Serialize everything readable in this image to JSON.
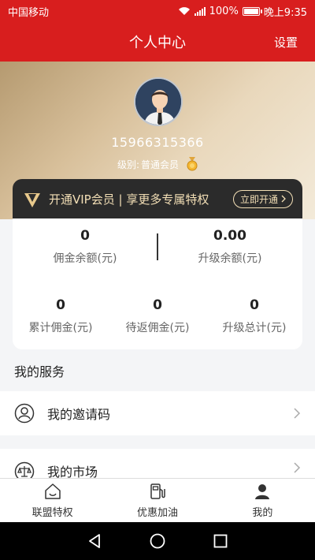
{
  "status_bar": {
    "carrier": "中国移动",
    "battery": "100%",
    "time": "晚上9:35"
  },
  "nav": {
    "title": "个人中心",
    "settings": "设置"
  },
  "profile": {
    "phone": "15966315366",
    "level_label": "级别:",
    "level_value": "普通会员"
  },
  "vip": {
    "text": "开通VIP会员 | 享更多专属特权",
    "button": "立即开通"
  },
  "stats": {
    "commission_balance": {
      "value": "0",
      "label": "佣金余额(元)"
    },
    "upgrade_balance": {
      "value": "0.00",
      "label": "升级余额(元)"
    },
    "total_commission": {
      "value": "0",
      "label": "累计佣金(元)"
    },
    "pending_commission": {
      "value": "0",
      "label": "待返佣金(元)"
    },
    "upgrade_total": {
      "value": "0",
      "label": "升级总计(元)"
    }
  },
  "services": {
    "title": "我的服务",
    "items": [
      {
        "label": "我的邀请码",
        "icon": "person-circle-icon"
      },
      {
        "label": "我的市场",
        "icon": "scales-icon"
      }
    ]
  },
  "tabs": [
    {
      "label": "联盟特权",
      "icon": "home-icon",
      "active": false
    },
    {
      "label": "优惠加油",
      "icon": "fuel-pump-icon",
      "active": false
    },
    {
      "label": "我的",
      "icon": "user-icon",
      "active": true
    }
  ],
  "colors": {
    "brand_red": "#d81e1e",
    "gold": "#d8c09b",
    "vip_dark": "#2b2b2b"
  }
}
